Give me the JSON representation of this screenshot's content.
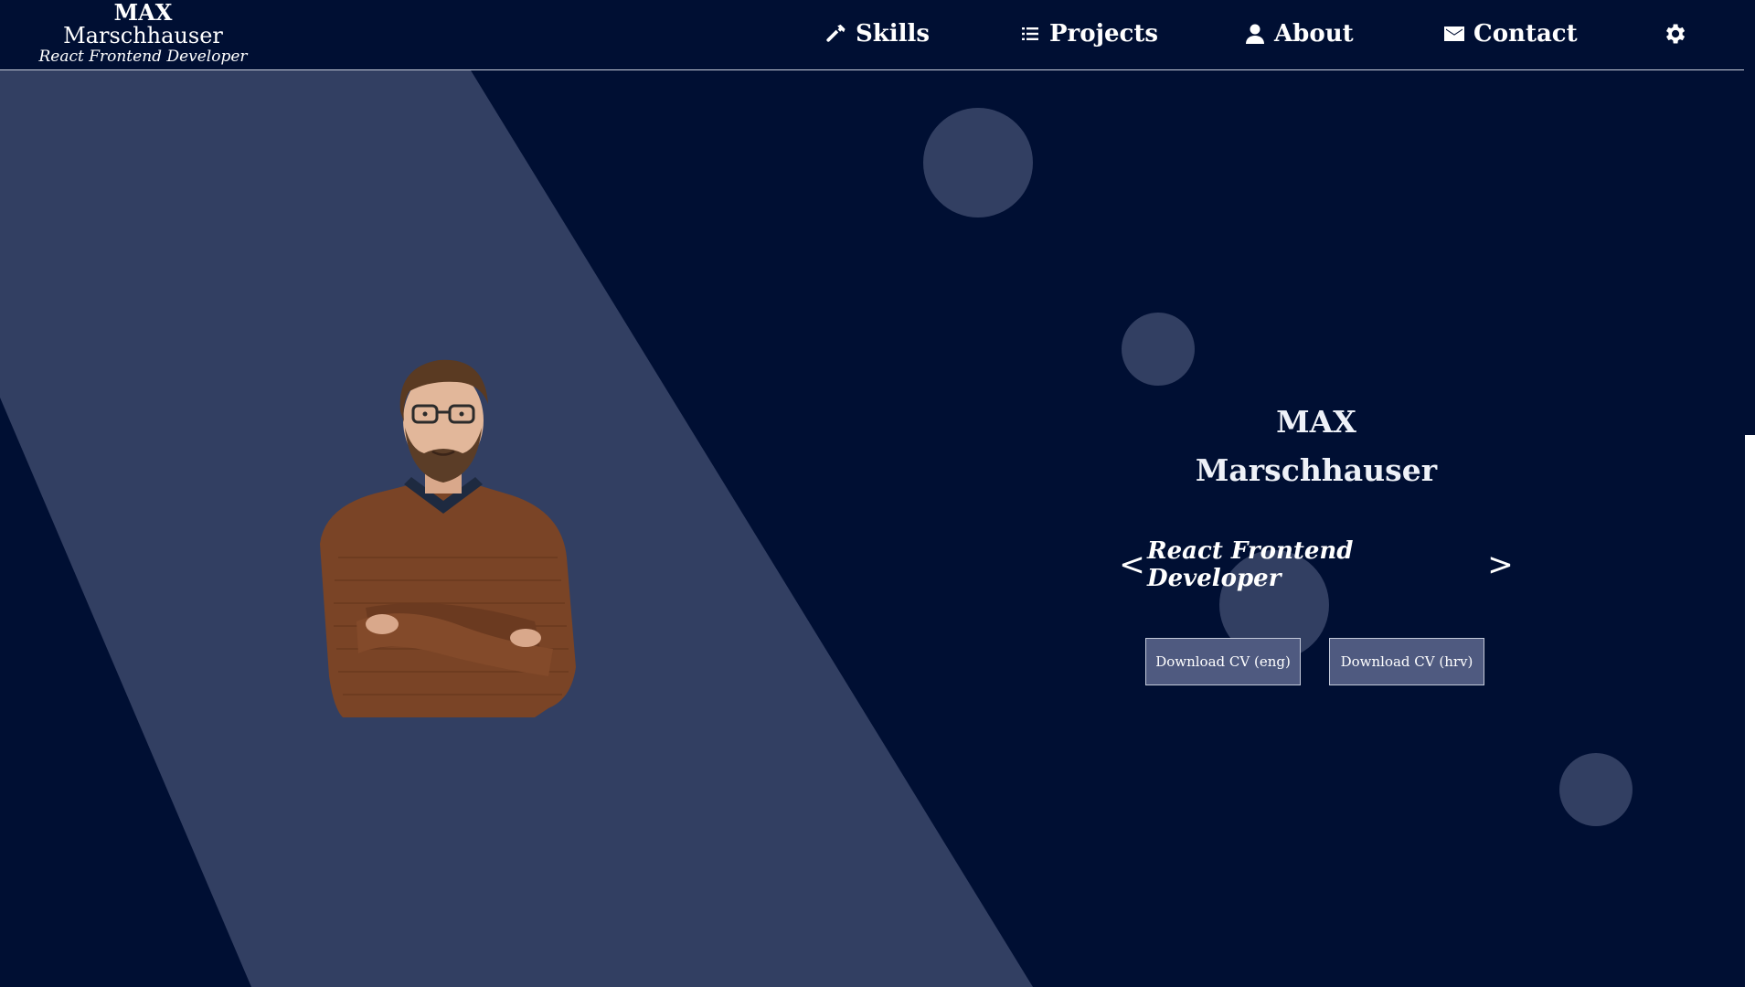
{
  "brand": {
    "first_name": "MAX",
    "last_name": "Marschhauser",
    "role": "React Frontend Developer"
  },
  "nav": {
    "items": [
      {
        "label": "Skills",
        "icon": "hammer-icon"
      },
      {
        "label": "Projects",
        "icon": "list-icon"
      },
      {
        "label": "About",
        "icon": "person-icon"
      },
      {
        "label": "Contact",
        "icon": "envelope-icon"
      }
    ],
    "settings_icon": "gear-icon"
  },
  "hero": {
    "first_name": "MAX",
    "last_name": "Marschhauser",
    "role": "React Frontend Developer",
    "prev_label": "<",
    "next_label": ">",
    "buttons": {
      "cv_eng": "Download CV (eng)",
      "cv_hrv": "Download CV (hrv)"
    }
  },
  "colors": {
    "background": "#000f33",
    "accent_panel": "#323f62",
    "button": "#4f5a80",
    "text": "#ffffff"
  }
}
